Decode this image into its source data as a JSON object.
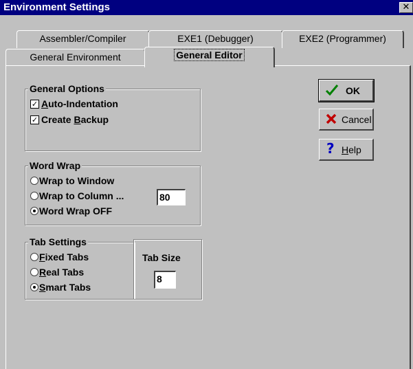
{
  "window": {
    "title": "Environment Settings",
    "close": "✕"
  },
  "tabs": {
    "row1": [
      "Assembler/Compiler",
      "EXE1 (Debugger)",
      "EXE2 (Programmer)"
    ],
    "row2": [
      "General Environment",
      "General Editor"
    ],
    "active": "General Editor"
  },
  "general_options": {
    "title": "General Options",
    "auto_indent": {
      "pre": "",
      "u": "A",
      "post": "uto-Indentation",
      "checked": true
    },
    "create_backup": {
      "pre": "Create ",
      "u": "B",
      "post": "ackup",
      "checked": true
    }
  },
  "word_wrap": {
    "title": "Word Wrap",
    "opt1": "Wrap to Window",
    "opt2": "Wrap to Column ...",
    "opt3": "Word Wrap OFF",
    "selected": "Word Wrap OFF",
    "column_value": "80"
  },
  "tab_settings": {
    "title": "Tab Settings",
    "fixed": {
      "u": "F",
      "post": "ixed Tabs"
    },
    "real": {
      "u": "R",
      "post": "eal Tabs"
    },
    "smart": {
      "u": "S",
      "post": "mart Tabs"
    },
    "selected": "Smart Tabs",
    "tab_size_label": "Tab Size",
    "tab_size_value": "8"
  },
  "buttons": {
    "ok": {
      "label": "OK",
      "color": "#008000"
    },
    "cancel": {
      "label": "Cancel",
      "color": "#c00000"
    },
    "help": {
      "u": "H",
      "post": "elp",
      "color": "#0000c0"
    }
  },
  "icons": {
    "ok": "checkmark-icon",
    "cancel": "x-icon",
    "help": "question-icon"
  }
}
